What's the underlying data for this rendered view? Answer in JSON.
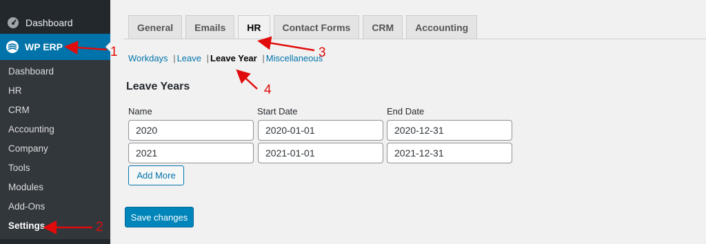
{
  "sidebar": {
    "dashboard_label": "Dashboard",
    "wperp_label": "WP ERP",
    "submenu": [
      "Dashboard",
      "HR",
      "CRM",
      "Accounting",
      "Company",
      "Tools",
      "Modules",
      "Add-Ons",
      "Settings"
    ],
    "active_sub": "Settings",
    "colors": {
      "bg": "#23282d",
      "sub_bg": "#32373c",
      "active": "#0073aa"
    }
  },
  "tabs": [
    "General",
    "Emails",
    "HR",
    "Contact Forms",
    "CRM",
    "Accounting"
  ],
  "active_tab": "HR",
  "subnav": {
    "items": [
      "Workdays",
      "Leave",
      "Leave Year",
      "Miscellaneous"
    ],
    "separator": "|",
    "current": "Leave Year"
  },
  "section_title": "Leave Years",
  "columns": {
    "name": "Name",
    "start": "Start Date",
    "end": "End Date"
  },
  "rows": [
    {
      "name": "2020",
      "start": "2020-01-01",
      "end": "2020-12-31"
    },
    {
      "name": "2021",
      "start": "2021-01-01",
      "end": "2021-12-31"
    }
  ],
  "add_more_label": "Add More",
  "save_label": "Save changes",
  "annotations": [
    "1",
    "2",
    "3",
    "4"
  ],
  "annotation_color": "#e20b0b"
}
